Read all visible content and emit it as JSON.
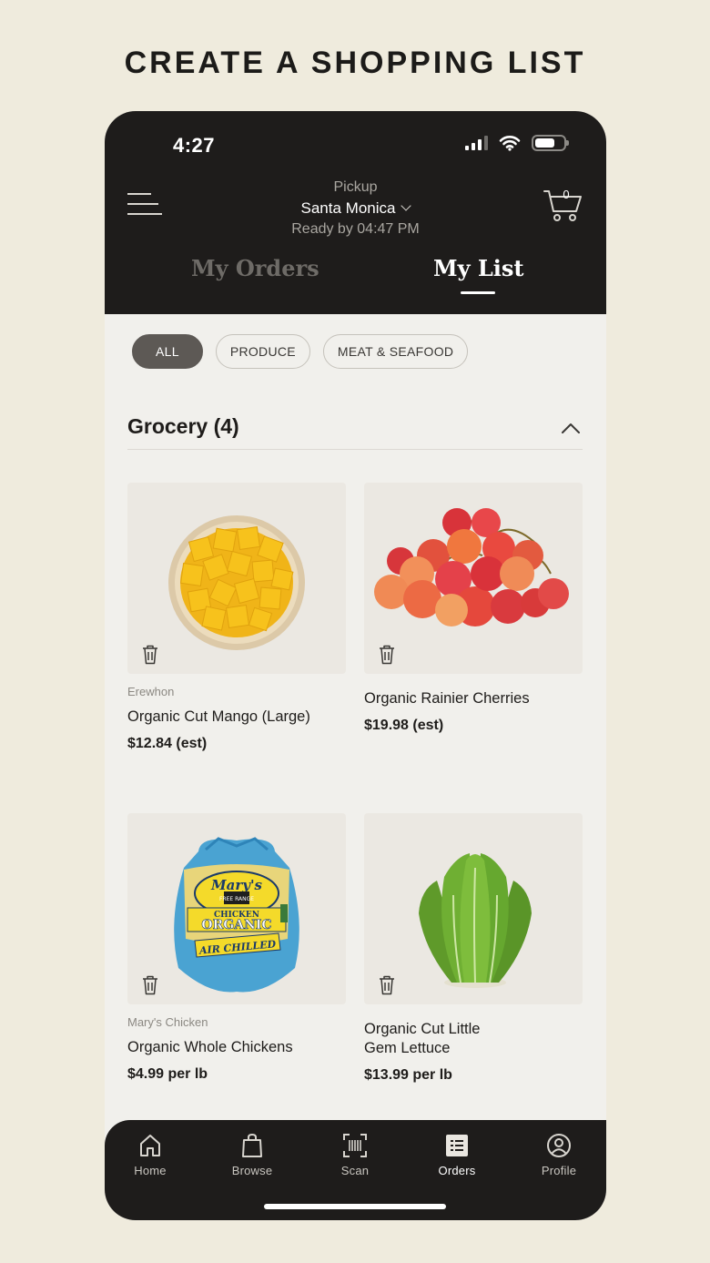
{
  "promo": {
    "title": "CREATE A SHOPPING LIST"
  },
  "status_bar": {
    "time": "4:27"
  },
  "header": {
    "mode": "Pickup",
    "store": "Santa Monica",
    "ready": "Ready by 04:47 PM",
    "cart_count": "0"
  },
  "tabs": [
    {
      "label": "My Orders",
      "active": false
    },
    {
      "label": "My List",
      "active": true
    }
  ],
  "filters": [
    {
      "label": "ALL",
      "active": true
    },
    {
      "label": "PRODUCE",
      "active": false
    },
    {
      "label": "MEAT & SEAFOOD",
      "active": false
    }
  ],
  "section": {
    "title": "Grocery (4)"
  },
  "products": [
    {
      "brand": "Erewhon",
      "name": "Organic Cut Mango (Large)",
      "price": "$12.84 (est)",
      "image": "mango-bowl"
    },
    {
      "brand": "",
      "name": "Organic Rainier Cherries",
      "price": "$19.98 (est)",
      "image": "cherries"
    },
    {
      "brand": "Mary's Chicken",
      "name": "Organic Whole Chickens",
      "price": "$4.99 per lb",
      "image": "whole-chicken"
    },
    {
      "brand": "",
      "name": "Organic Cut Little Gem Lettuce",
      "price": "$13.99 per lb",
      "image": "lettuce"
    }
  ],
  "chicken_label": {
    "brand": "Mary's",
    "line1": "FREE RANGE",
    "line2": "CHICKEN",
    "line3": "ORGANIC",
    "line4": "AIR CHILLED"
  },
  "bottom_nav": [
    {
      "label": "Home",
      "icon": "home-icon",
      "active": false
    },
    {
      "label": "Browse",
      "icon": "bag-icon",
      "active": false
    },
    {
      "label": "Scan",
      "icon": "barcode-icon",
      "active": false
    },
    {
      "label": "Orders",
      "icon": "list-icon",
      "active": true
    },
    {
      "label": "Profile",
      "icon": "profile-icon",
      "active": false
    }
  ]
}
